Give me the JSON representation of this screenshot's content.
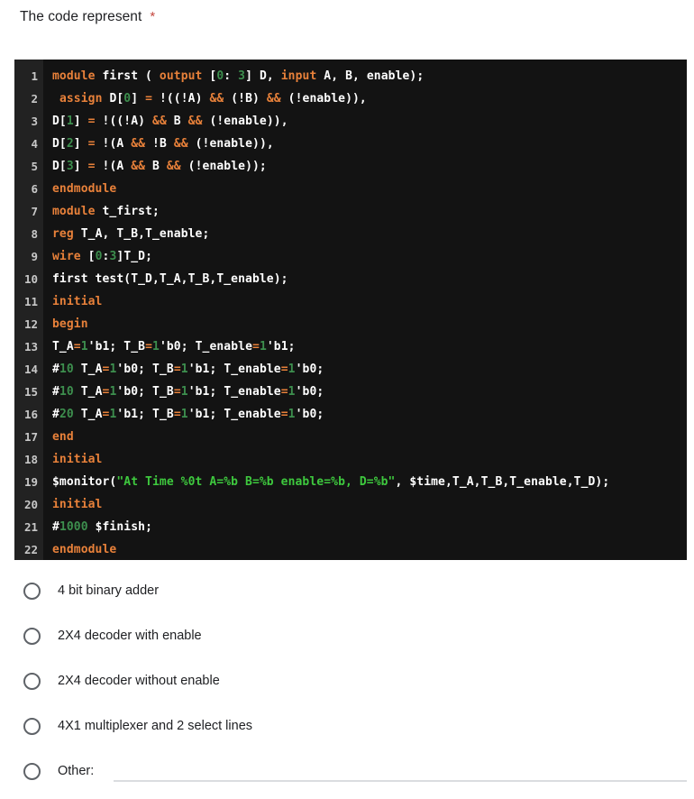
{
  "question": {
    "title": "The code represent",
    "required_marker": "*"
  },
  "code": {
    "language": "verilog",
    "line_numbers": [
      "1",
      "2",
      "3",
      "4",
      "5",
      "6",
      "7",
      "8",
      "9",
      "10",
      "11",
      "12",
      "13",
      "14",
      "15",
      "16",
      "17",
      "18",
      "19",
      "20",
      "21",
      "22"
    ],
    "lines": [
      "module first ( output [0: 3] D, input A, B, enable);",
      " assign D[0] = !((!A) && (!B) && (!enable)),",
      "D[1] = !((!A) && B && (!enable)),",
      "D[2] = !(A && !B && (!enable)),",
      "D[3] = !(A && B && (!enable));",
      "endmodule",
      "module t_first;",
      "reg T_A, T_B,T_enable;",
      "wire [0:3]T_D;",
      "first test(T_D,T_A,T_B,T_enable);",
      "initial",
      "begin",
      "T_A=1'b1; T_B=1'b0; T_enable=1'b1;",
      "#10 T_A=1'b0; T_B=1'b1; T_enable=1'b0;",
      "#10 T_A=1'b0; T_B=1'b1; T_enable=1'b0;",
      "#20 T_A=1'b1; T_B=1'b1; T_enable=1'b0;",
      "end",
      "initial",
      "$monitor(\"At Time %0t A=%b B=%b enable=%b, D=%b\", $time,T_A,T_B,T_enable,T_D);",
      "initial",
      "#1000 $finish;",
      "endmodule"
    ],
    "tokens": [
      [
        {
          "t": "module ",
          "c": "kw"
        },
        {
          "t": "first ( ",
          "c": ""
        },
        {
          "t": "output ",
          "c": "kw"
        },
        {
          "t": "[",
          "c": ""
        },
        {
          "t": "0",
          "c": "num"
        },
        {
          "t": ": ",
          "c": ""
        },
        {
          "t": "3",
          "c": "num"
        },
        {
          "t": "] D, ",
          "c": ""
        },
        {
          "t": "input ",
          "c": "kw"
        },
        {
          "t": "A, B, enable);",
          "c": ""
        }
      ],
      [
        {
          "t": " ",
          "c": ""
        },
        {
          "t": "assign ",
          "c": "kw"
        },
        {
          "t": "D[",
          "c": ""
        },
        {
          "t": "0",
          "c": "num"
        },
        {
          "t": "] ",
          "c": ""
        },
        {
          "t": "=",
          "c": "op"
        },
        {
          "t": " !((!A) ",
          "c": ""
        },
        {
          "t": "&&",
          "c": "op"
        },
        {
          "t": " (!B) ",
          "c": ""
        },
        {
          "t": "&&",
          "c": "op"
        },
        {
          "t": " (!enable)),",
          "c": ""
        }
      ],
      [
        {
          "t": "D[",
          "c": ""
        },
        {
          "t": "1",
          "c": "num"
        },
        {
          "t": "] ",
          "c": ""
        },
        {
          "t": "=",
          "c": "op"
        },
        {
          "t": " !((!A) ",
          "c": ""
        },
        {
          "t": "&&",
          "c": "op"
        },
        {
          "t": " B ",
          "c": ""
        },
        {
          "t": "&&",
          "c": "op"
        },
        {
          "t": " (!enable)),",
          "c": ""
        }
      ],
      [
        {
          "t": "D[",
          "c": ""
        },
        {
          "t": "2",
          "c": "num"
        },
        {
          "t": "] ",
          "c": ""
        },
        {
          "t": "=",
          "c": "op"
        },
        {
          "t": " !(A ",
          "c": ""
        },
        {
          "t": "&&",
          "c": "op"
        },
        {
          "t": " !B ",
          "c": ""
        },
        {
          "t": "&&",
          "c": "op"
        },
        {
          "t": " (!enable)),",
          "c": ""
        }
      ],
      [
        {
          "t": "D[",
          "c": ""
        },
        {
          "t": "3",
          "c": "num"
        },
        {
          "t": "] ",
          "c": ""
        },
        {
          "t": "=",
          "c": "op"
        },
        {
          "t": " !(A ",
          "c": ""
        },
        {
          "t": "&&",
          "c": "op"
        },
        {
          "t": " B ",
          "c": ""
        },
        {
          "t": "&&",
          "c": "op"
        },
        {
          "t": " (!enable));",
          "c": ""
        }
      ],
      [
        {
          "t": "endmodule",
          "c": "kw"
        }
      ],
      [
        {
          "t": "module ",
          "c": "kw"
        },
        {
          "t": "t_first;",
          "c": ""
        }
      ],
      [
        {
          "t": "reg ",
          "c": "kw"
        },
        {
          "t": "T_A, T_B,T_enable;",
          "c": ""
        }
      ],
      [
        {
          "t": "wire ",
          "c": "kw"
        },
        {
          "t": "[",
          "c": ""
        },
        {
          "t": "0",
          "c": "num"
        },
        {
          "t": ":",
          "c": ""
        },
        {
          "t": "3",
          "c": "num"
        },
        {
          "t": "]T_D;",
          "c": ""
        }
      ],
      [
        {
          "t": "first test(T_D,T_A,T_B,T_enable);",
          "c": ""
        }
      ],
      [
        {
          "t": "initial",
          "c": "kw"
        }
      ],
      [
        {
          "t": "begin",
          "c": "kw"
        }
      ],
      [
        {
          "t": "T_A",
          "c": ""
        },
        {
          "t": "=",
          "c": "op"
        },
        {
          "t": "1",
          "c": "num"
        },
        {
          "t": "'b1; T_B",
          "c": ""
        },
        {
          "t": "=",
          "c": "op"
        },
        {
          "t": "1",
          "c": "num"
        },
        {
          "t": "'b0; T_enable",
          "c": ""
        },
        {
          "t": "=",
          "c": "op"
        },
        {
          "t": "1",
          "c": "num"
        },
        {
          "t": "'b1;",
          "c": ""
        }
      ],
      [
        {
          "t": "#",
          "c": ""
        },
        {
          "t": "10",
          "c": "num"
        },
        {
          "t": " T_A",
          "c": ""
        },
        {
          "t": "=",
          "c": "op"
        },
        {
          "t": "1",
          "c": "num"
        },
        {
          "t": "'b0; T_B",
          "c": ""
        },
        {
          "t": "=",
          "c": "op"
        },
        {
          "t": "1",
          "c": "num"
        },
        {
          "t": "'b1; T_enable",
          "c": ""
        },
        {
          "t": "=",
          "c": "op"
        },
        {
          "t": "1",
          "c": "num"
        },
        {
          "t": "'b0;",
          "c": ""
        }
      ],
      [
        {
          "t": "#",
          "c": ""
        },
        {
          "t": "10",
          "c": "num"
        },
        {
          "t": " T_A",
          "c": ""
        },
        {
          "t": "=",
          "c": "op"
        },
        {
          "t": "1",
          "c": "num"
        },
        {
          "t": "'b0; T_B",
          "c": ""
        },
        {
          "t": "=",
          "c": "op"
        },
        {
          "t": "1",
          "c": "num"
        },
        {
          "t": "'b1; T_enable",
          "c": ""
        },
        {
          "t": "=",
          "c": "op"
        },
        {
          "t": "1",
          "c": "num"
        },
        {
          "t": "'b0;",
          "c": ""
        }
      ],
      [
        {
          "t": "#",
          "c": ""
        },
        {
          "t": "20",
          "c": "num"
        },
        {
          "t": " T_A",
          "c": ""
        },
        {
          "t": "=",
          "c": "op"
        },
        {
          "t": "1",
          "c": "num"
        },
        {
          "t": "'b1; T_B",
          "c": ""
        },
        {
          "t": "=",
          "c": "op"
        },
        {
          "t": "1",
          "c": "num"
        },
        {
          "t": "'b1; T_enable",
          "c": ""
        },
        {
          "t": "=",
          "c": "op"
        },
        {
          "t": "1",
          "c": "num"
        },
        {
          "t": "'b0;",
          "c": ""
        }
      ],
      [
        {
          "t": "end",
          "c": "kw"
        }
      ],
      [
        {
          "t": "initial",
          "c": "kw"
        }
      ],
      [
        {
          "t": "$monitor(",
          "c": ""
        },
        {
          "t": "\"At Time %0t A=%b B=%b enable=%b, D=%b\"",
          "c": "str"
        },
        {
          "t": ", $time,T_A,T_B,T_enable,T_D);",
          "c": ""
        }
      ],
      [
        {
          "t": "initial",
          "c": "kw"
        }
      ],
      [
        {
          "t": "#",
          "c": ""
        },
        {
          "t": "1000",
          "c": "num"
        },
        {
          "t": " $finish;",
          "c": ""
        }
      ],
      [
        {
          "t": "endmodule",
          "c": "kw"
        }
      ]
    ]
  },
  "options": [
    {
      "id": "opt-4bit-binary-adder",
      "label": "4 bit binary adder",
      "selected": false
    },
    {
      "id": "opt-2x4-decoder-with-enable",
      "label": "2X4 decoder with enable",
      "selected": false
    },
    {
      "id": "opt-2x4-decoder-without-enable",
      "label": "2X4 decoder without enable",
      "selected": false
    },
    {
      "id": "opt-4x1-multiplexer",
      "label": "4X1 multiplexer and 2 select lines",
      "selected": false
    }
  ],
  "other_option": {
    "label": "Other:",
    "value": "",
    "placeholder": "",
    "selected": false
  },
  "colors": {
    "code_background": "#131313",
    "gutter_background": "#222222",
    "keyword": "#e8813a",
    "number": "#3d8f4e",
    "string": "#3ec93e",
    "code_text": "#ffffff",
    "line_number": "#c8c8c8",
    "required_star": "#c5473f",
    "radio_border": "#5f6368",
    "input_underline": "#dadce0"
  }
}
